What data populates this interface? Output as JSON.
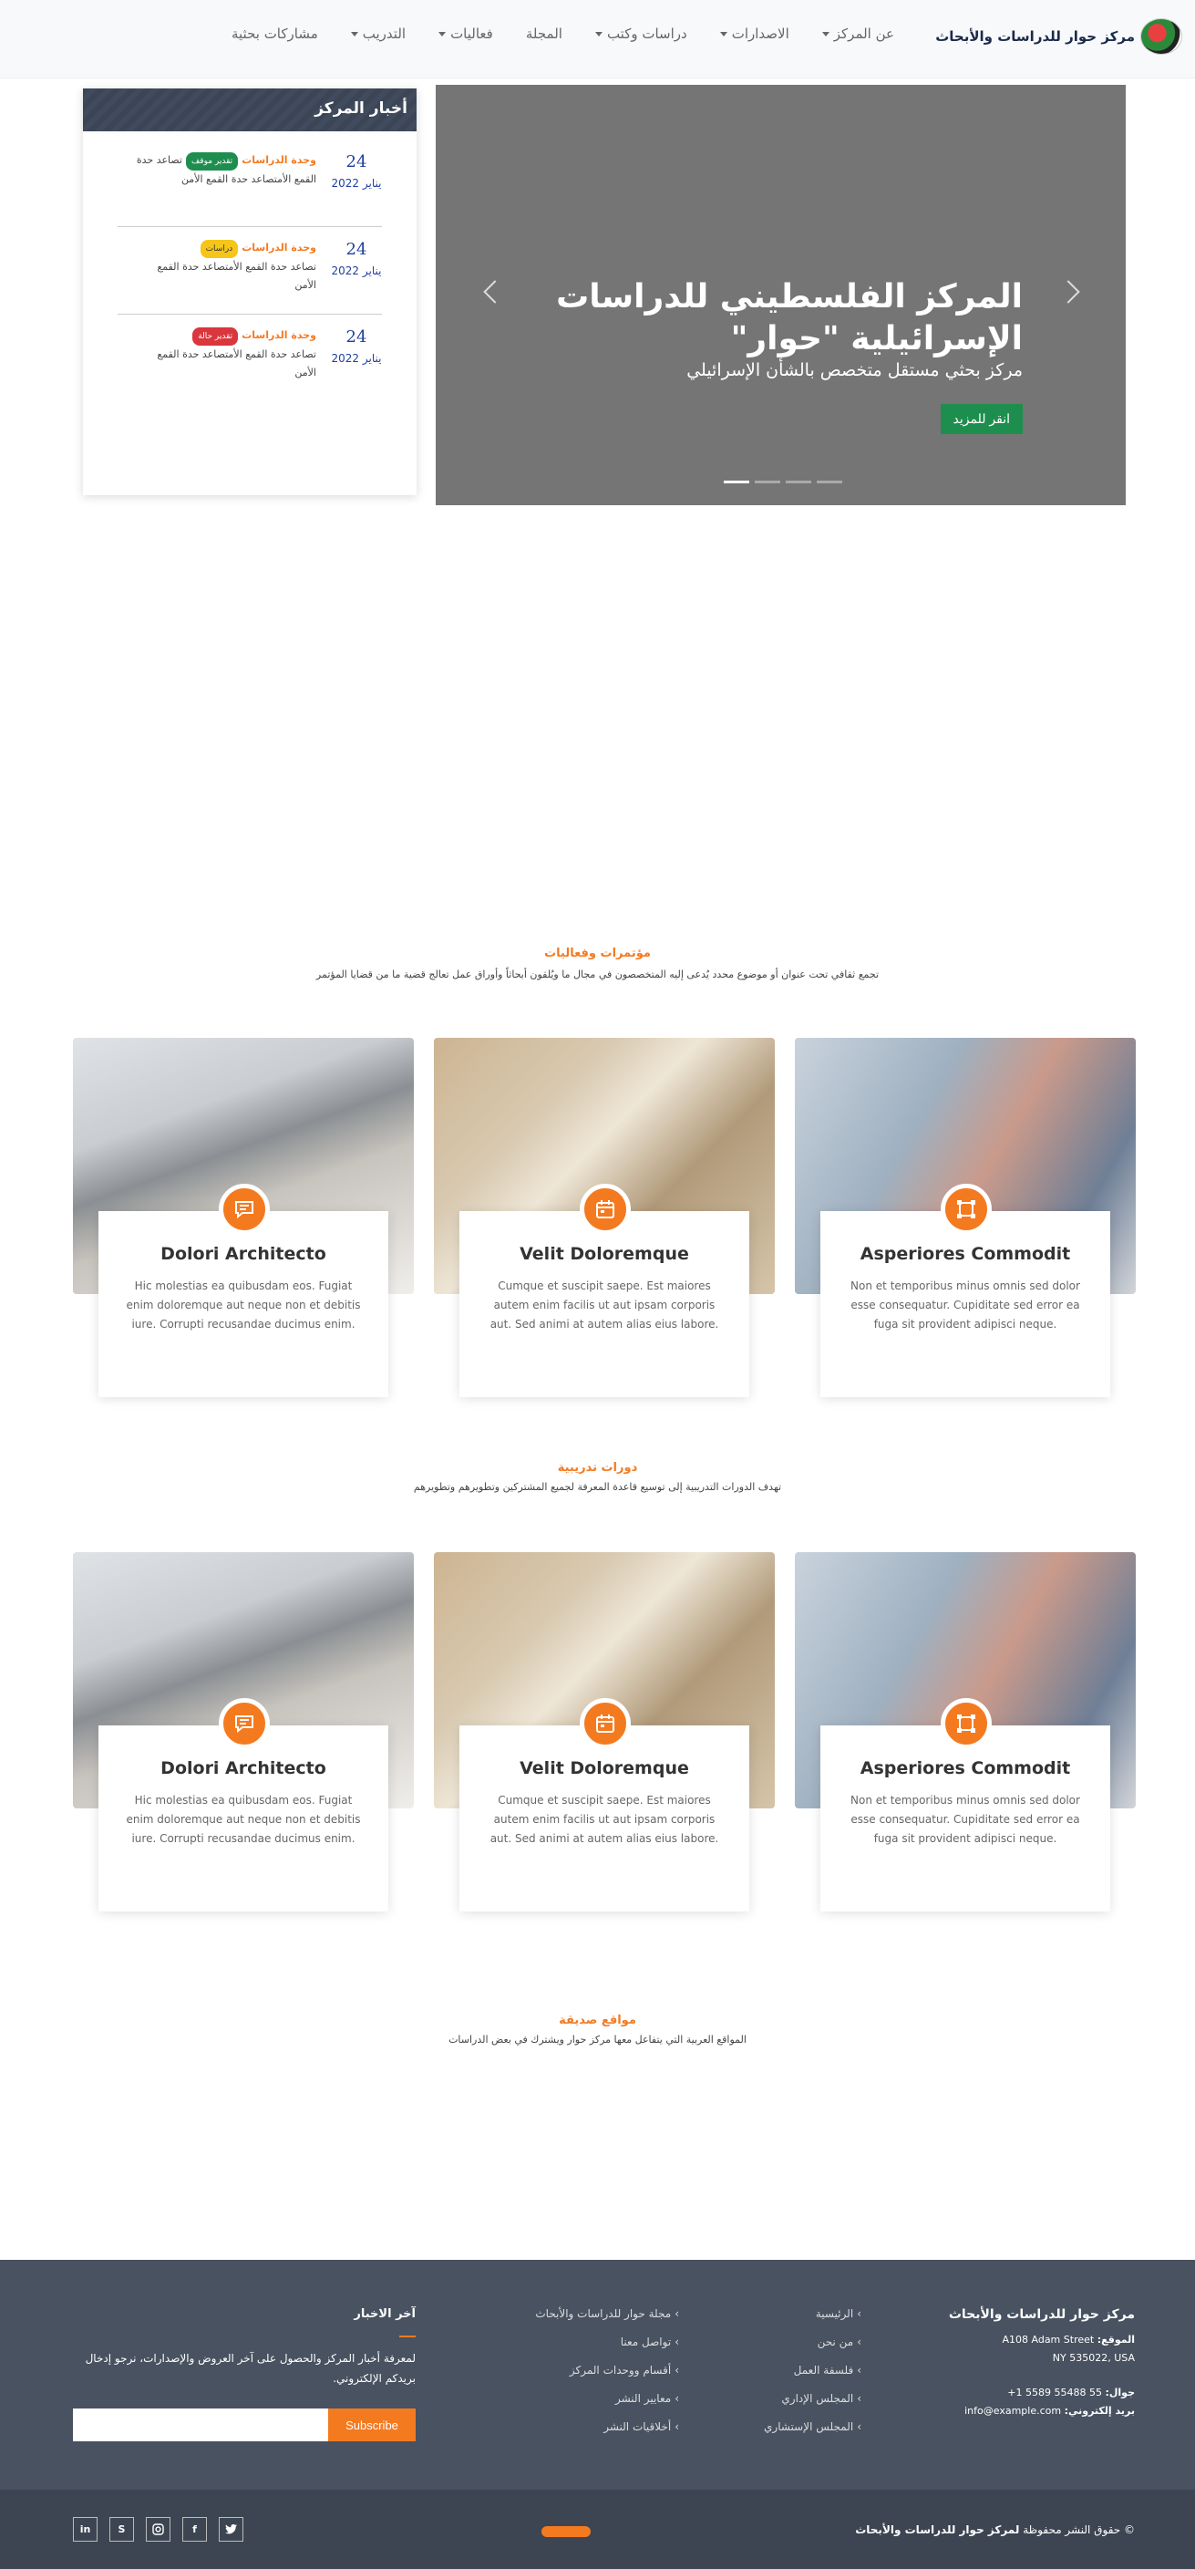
{
  "header": {
    "brand": "مركز حوار للدراسات والأبحاث",
    "nav": [
      {
        "label": "عن المركز",
        "dropdown": true
      },
      {
        "label": "الاصدارات",
        "dropdown": true
      },
      {
        "label": "دراسات وكتب",
        "dropdown": true
      },
      {
        "label": "المجلة",
        "dropdown": false
      },
      {
        "label": "فعاليات",
        "dropdown": true
      },
      {
        "label": "التدريب",
        "dropdown": true
      },
      {
        "label": "مشاركات بحثية",
        "dropdown": false
      }
    ]
  },
  "hero": {
    "title": "المركز الفلسطيني للدراسات الإسرائيلية \"حوار\"",
    "subtitle": "مركز بحثي مستقل متخصص بالشأن الإسرائيلي",
    "button": "انقر للمزيد",
    "slides": 4,
    "active_slide": 1
  },
  "news": {
    "title": "أخبار المركز",
    "items": [
      {
        "day": "24",
        "month": "يناير 2022",
        "unit": "وحدة الدراسات",
        "badge": "تقدير موقف",
        "badge_color": "#1e8e4e",
        "text_a": "تصاعد حدة",
        "text_b": "القمع الأمتصاعد حدة القمع الأمن"
      },
      {
        "day": "24",
        "month": "يناير 2022",
        "unit": "وحدة الدراسات",
        "badge": "دراسات",
        "badge_color": "#f5c518",
        "text_a": "تصاعد حدة القمع الأمتصاعد حدة القمع",
        "text_b": "الأمن"
      },
      {
        "day": "24",
        "month": "يناير 2022",
        "unit": "وحدة الدراسات",
        "badge": "تقدير حالة",
        "badge_color": "#d9363e",
        "text_a": "تصاعد حدة القمع الأمتصاعد حدة القمع",
        "text_b": "الأمن"
      }
    ]
  },
  "conferences": {
    "title": "مؤتمرات وفعاليات",
    "desc": "تجمع ثقافي تحت عنوان أو موضوع محدد يُدعى إليه المتخصصون في مجال ما ويُلقون أبحاثاً وأوراق عمل تعالج قضية ما من قضايا المؤتمر",
    "cards": [
      {
        "title": "Asperiores Commodit",
        "text": "Non et temporibus minus omnis sed dolor esse consequatur. Cupiditate sed error ea fuga sit provident adipisci neque.",
        "icon": "vector-square-icon"
      },
      {
        "title": "Velit Doloremque",
        "text": "Cumque et suscipit saepe. Est maiores autem enim facilis ut aut ipsam corporis aut. Sed animi at autem alias eius labore.",
        "icon": "calendar-icon"
      },
      {
        "title": "Dolori Architecto",
        "text": "Hic molestias ea quibusdam eos. Fugiat enim doloremque aut neque non et debitis iure. Corrupti recusandae ducimus enim.",
        "icon": "chat-icon"
      }
    ]
  },
  "training": {
    "title": "دورات تدريبية",
    "desc": "تهدف الدورات التدريبية إلى توسيع قاعدة المعرفة لجميع المشتركين وتطويرهم وتطويرهم",
    "cards": [
      {
        "title": "Asperiores Commodit",
        "text": "Non et temporibus minus omnis sed dolor esse consequatur. Cupiditate sed error ea fuga sit provident adipisci neque.",
        "icon": "vector-square-icon"
      },
      {
        "title": "Velit Doloremque",
        "text": "Cumque et suscipit saepe. Est maiores autem enim facilis ut aut ipsam corporis aut. Sed animi at autem alias eius labore.",
        "icon": "calendar-icon"
      },
      {
        "title": "Dolori Architecto",
        "text": "Hic molestias ea quibusdam eos. Fugiat enim doloremque aut neque non et debitis iure. Corrupti recusandae ducimus enim.",
        "icon": "chat-icon"
      }
    ]
  },
  "friends": {
    "title": "مواقع صديقة",
    "desc": "المواقع العربية التي يتفاعل معها مركز حوار ويشترك في بعض الدراسات"
  },
  "footer": {
    "brand": "مركز حوار للدراسات والأبحاث",
    "location_label": "الموقع:",
    "address1": "A108 Adam Street",
    "address2": "NY 535022, USA",
    "phone_label": "جوال:",
    "phone": "+1 5589 55488 55",
    "email_label": "بريد إلكتروني:",
    "email": "info@example.com",
    "links_col1": [
      "الرئيسية",
      "من نحن",
      "فلسفة العمل",
      "المجلس الإداري",
      "المجلس الإستشاري"
    ],
    "links_col2": [
      "مجلة حوار للدراسات والأبحاث",
      "تواصل معنا",
      "أقسام ووحدات المركز",
      "معايير النشر",
      "أخلاقيات النشر"
    ],
    "news_title": "آخر الاخبار",
    "news_text": "لمعرفة أخبار المركز والحصول على آخر العروض والإصدارات، نرجو إدخال بريدكم الإلكتروني.",
    "subscribe": "Subscribe",
    "email_placeholder": ""
  },
  "bottom": {
    "copyright_prefix": "© حقوق النشر محفوظة",
    "copyright_brand": "لمركز حوار للدراسات والأبحاث",
    "socials": [
      "twitter",
      "facebook",
      "instagram",
      "skype",
      "linkedin"
    ]
  },
  "colors": {
    "accent": "#f47a20",
    "dark": "#485260",
    "green": "#1e8e4e"
  }
}
